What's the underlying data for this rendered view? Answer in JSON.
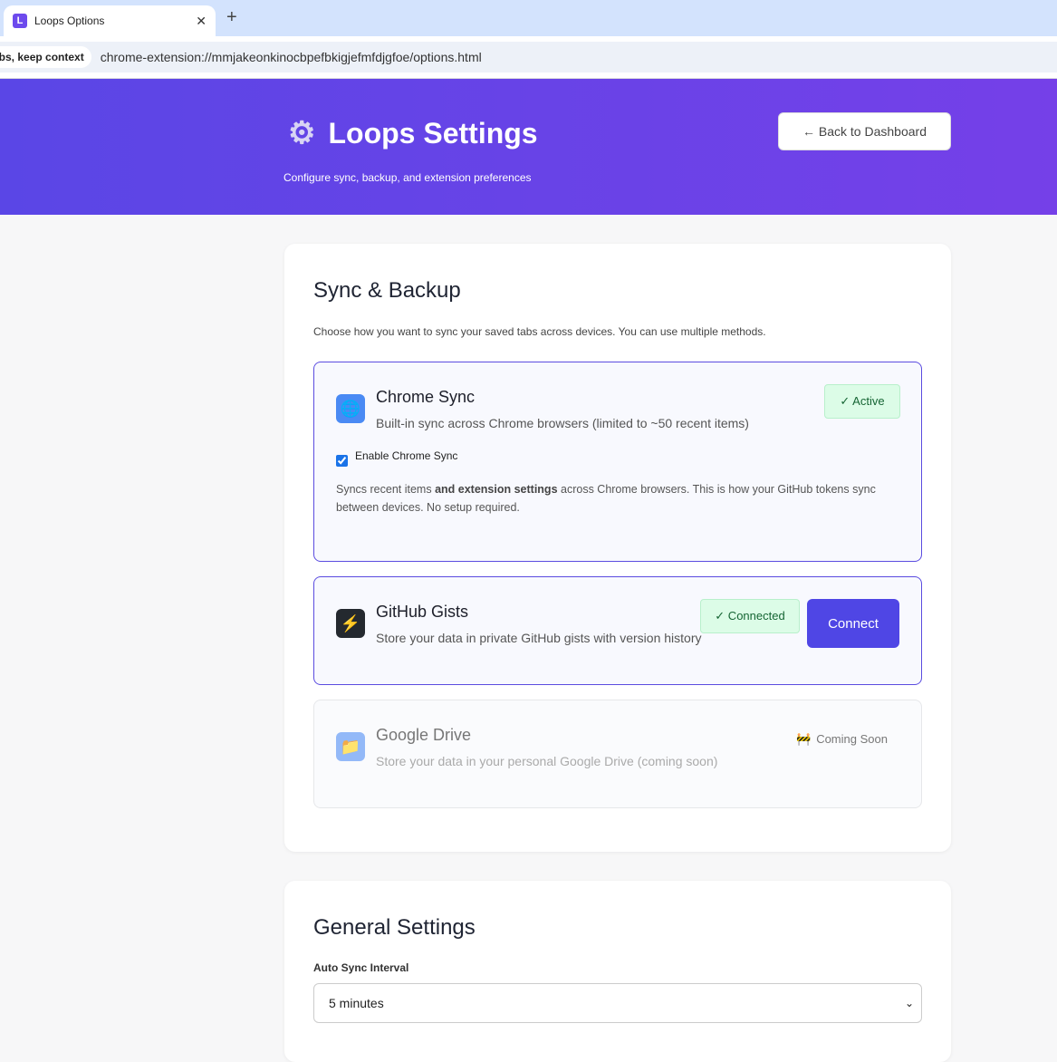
{
  "browser": {
    "tab_title": "Loops Options",
    "favicon_letter": "L",
    "chip": "abs, keep context",
    "url": "chrome-extension://mmjakeonkinocbpefbkigjefmfdjgfoe/options.html"
  },
  "header": {
    "title": "Loops Settings",
    "subtitle": "Configure sync, backup, and extension preferences",
    "back_label": "← Back to Dashboard"
  },
  "sync": {
    "title": "Sync & Backup",
    "intro": "Choose how you want to sync your saved tabs across devices. You can use multiple methods.",
    "chrome": {
      "title": "Chrome Sync",
      "desc": "Built-in sync across Chrome browsers (limited to ~50 recent items)",
      "badge": "✓ Active",
      "checkbox_label": "Enable Chrome Sync",
      "checked": true,
      "note_pre": "Syncs recent items ",
      "note_bold": "and extension settings",
      "note_post": " across Chrome browsers. This is how your GitHub tokens sync between devices. No setup required."
    },
    "github": {
      "title": "GitHub Gists",
      "desc": "Store your data in private GitHub gists with version history",
      "badge": "✓ Connected",
      "button": "Connect"
    },
    "gdrive": {
      "title": "Google Drive",
      "desc": "Store your data in your personal Google Drive (coming soon)",
      "badge": "Coming Soon"
    }
  },
  "general": {
    "title": "General Settings",
    "interval_label": "Auto Sync Interval",
    "interval_value": "5 minutes"
  }
}
